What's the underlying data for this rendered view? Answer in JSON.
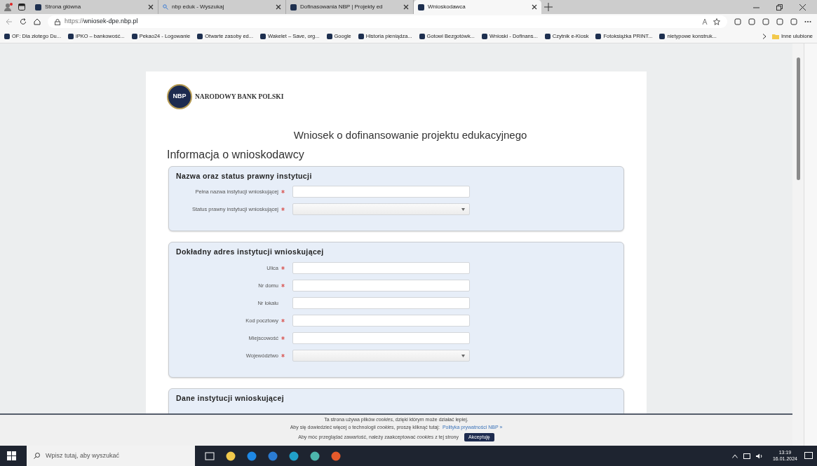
{
  "browser": {
    "tabs": [
      {
        "title": "Strona główna",
        "selected": false
      },
      {
        "title": "nbp eduk - Wyszukaj",
        "selected": false
      },
      {
        "title": "Dofinasowania NBP | Projekty ed",
        "selected": false
      },
      {
        "title": "Wnioskodawca",
        "selected": true
      }
    ],
    "url_scheme": "https://",
    "url_host": "wniosek-dpe.nbp.pl",
    "bookmarks": [
      "OF: Dla złotego Du...",
      "iPKO – bankowość...",
      "Pekao24 - Logowanie",
      "Otwarte zasoby ed...",
      "Wakelet – Save, org...",
      "Google",
      "Historia pieniądza...",
      "Gotowi Bezgotówk...",
      "Wnioski - Dofinans...",
      "Czytnik e-Kiosk",
      "Fotoksiążka PRINT...",
      "nietypowe konstruk..."
    ],
    "other_favorites": "Inne ulubione"
  },
  "page": {
    "logo_text": "NARODOWY BANK POLSKI",
    "logo_mark": "NBP",
    "title": "Wniosek o dofinansowanie projektu edukacyjnego",
    "section_title": "Informacja o wnioskodawcy",
    "fieldsets": [
      {
        "legend": "Nazwa oraz status prawny instytucji",
        "fields": [
          {
            "label": "Pełna nazwa instytucji wnioskującej",
            "required": true,
            "kind": "text"
          },
          {
            "label": "Status prawny instytucji wnioskującej",
            "required": true,
            "kind": "select"
          }
        ]
      },
      {
        "legend": "Dokładny adres instytucji wnioskującej",
        "fields": [
          {
            "label": "Ulica",
            "required": true,
            "kind": "text"
          },
          {
            "label": "Nr domu",
            "required": true,
            "kind": "text"
          },
          {
            "label": "Nr lokalu",
            "required": false,
            "kind": "text"
          },
          {
            "label": "Kod pocztowy",
            "required": true,
            "kind": "text"
          },
          {
            "label": "Miejscowość",
            "required": true,
            "kind": "text"
          },
          {
            "label": "Województwo",
            "required": true,
            "kind": "select"
          }
        ]
      },
      {
        "legend": "Dane instytucji wnioskującej"
      }
    ]
  },
  "cookie_bar": {
    "line_1": "Ta strona używa plików *cookies*, dzięki którym może działać lepiej.",
    "line_2": "Aby się dowiedzieć więcej o technologii *cookies*, proszę kliknąć tutaj:",
    "link": "Polityka prywatności NBP »",
    "line_3": "Aby móc przeglądać zawartość, należy zaakceptować *cookies* z tej strony",
    "button": "Akceptuję"
  },
  "taskbar": {
    "search_placeholder": "Wpisz tutaj, aby wyszukać",
    "time": "13:19",
    "date": "16.01.2024"
  }
}
